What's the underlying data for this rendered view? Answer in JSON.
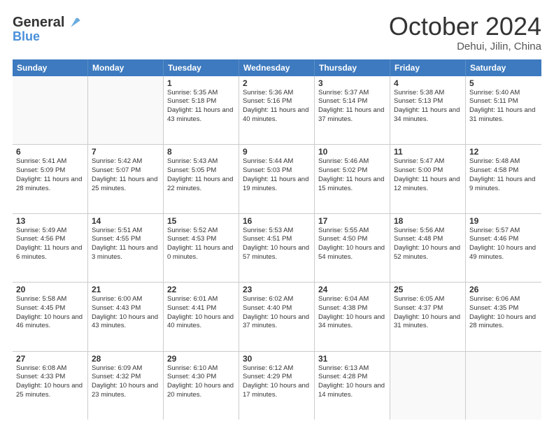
{
  "header": {
    "logo_general": "General",
    "logo_blue": "Blue",
    "month_title": "October 2024",
    "location": "Dehui, Jilin, China"
  },
  "days_of_week": [
    "Sunday",
    "Monday",
    "Tuesday",
    "Wednesday",
    "Thursday",
    "Friday",
    "Saturday"
  ],
  "weeks": [
    [
      {
        "day": "",
        "text": ""
      },
      {
        "day": "",
        "text": ""
      },
      {
        "day": "1",
        "text": "Sunrise: 5:35 AM\nSunset: 5:18 PM\nDaylight: 11 hours and 43 minutes."
      },
      {
        "day": "2",
        "text": "Sunrise: 5:36 AM\nSunset: 5:16 PM\nDaylight: 11 hours and 40 minutes."
      },
      {
        "day": "3",
        "text": "Sunrise: 5:37 AM\nSunset: 5:14 PM\nDaylight: 11 hours and 37 minutes."
      },
      {
        "day": "4",
        "text": "Sunrise: 5:38 AM\nSunset: 5:13 PM\nDaylight: 11 hours and 34 minutes."
      },
      {
        "day": "5",
        "text": "Sunrise: 5:40 AM\nSunset: 5:11 PM\nDaylight: 11 hours and 31 minutes."
      }
    ],
    [
      {
        "day": "6",
        "text": "Sunrise: 5:41 AM\nSunset: 5:09 PM\nDaylight: 11 hours and 28 minutes."
      },
      {
        "day": "7",
        "text": "Sunrise: 5:42 AM\nSunset: 5:07 PM\nDaylight: 11 hours and 25 minutes."
      },
      {
        "day": "8",
        "text": "Sunrise: 5:43 AM\nSunset: 5:05 PM\nDaylight: 11 hours and 22 minutes."
      },
      {
        "day": "9",
        "text": "Sunrise: 5:44 AM\nSunset: 5:03 PM\nDaylight: 11 hours and 19 minutes."
      },
      {
        "day": "10",
        "text": "Sunrise: 5:46 AM\nSunset: 5:02 PM\nDaylight: 11 hours and 15 minutes."
      },
      {
        "day": "11",
        "text": "Sunrise: 5:47 AM\nSunset: 5:00 PM\nDaylight: 11 hours and 12 minutes."
      },
      {
        "day": "12",
        "text": "Sunrise: 5:48 AM\nSunset: 4:58 PM\nDaylight: 11 hours and 9 minutes."
      }
    ],
    [
      {
        "day": "13",
        "text": "Sunrise: 5:49 AM\nSunset: 4:56 PM\nDaylight: 11 hours and 6 minutes."
      },
      {
        "day": "14",
        "text": "Sunrise: 5:51 AM\nSunset: 4:55 PM\nDaylight: 11 hours and 3 minutes."
      },
      {
        "day": "15",
        "text": "Sunrise: 5:52 AM\nSunset: 4:53 PM\nDaylight: 11 hours and 0 minutes."
      },
      {
        "day": "16",
        "text": "Sunrise: 5:53 AM\nSunset: 4:51 PM\nDaylight: 10 hours and 57 minutes."
      },
      {
        "day": "17",
        "text": "Sunrise: 5:55 AM\nSunset: 4:50 PM\nDaylight: 10 hours and 54 minutes."
      },
      {
        "day": "18",
        "text": "Sunrise: 5:56 AM\nSunset: 4:48 PM\nDaylight: 10 hours and 52 minutes."
      },
      {
        "day": "19",
        "text": "Sunrise: 5:57 AM\nSunset: 4:46 PM\nDaylight: 10 hours and 49 minutes."
      }
    ],
    [
      {
        "day": "20",
        "text": "Sunrise: 5:58 AM\nSunset: 4:45 PM\nDaylight: 10 hours and 46 minutes."
      },
      {
        "day": "21",
        "text": "Sunrise: 6:00 AM\nSunset: 4:43 PM\nDaylight: 10 hours and 43 minutes."
      },
      {
        "day": "22",
        "text": "Sunrise: 6:01 AM\nSunset: 4:41 PM\nDaylight: 10 hours and 40 minutes."
      },
      {
        "day": "23",
        "text": "Sunrise: 6:02 AM\nSunset: 4:40 PM\nDaylight: 10 hours and 37 minutes."
      },
      {
        "day": "24",
        "text": "Sunrise: 6:04 AM\nSunset: 4:38 PM\nDaylight: 10 hours and 34 minutes."
      },
      {
        "day": "25",
        "text": "Sunrise: 6:05 AM\nSunset: 4:37 PM\nDaylight: 10 hours and 31 minutes."
      },
      {
        "day": "26",
        "text": "Sunrise: 6:06 AM\nSunset: 4:35 PM\nDaylight: 10 hours and 28 minutes."
      }
    ],
    [
      {
        "day": "27",
        "text": "Sunrise: 6:08 AM\nSunset: 4:33 PM\nDaylight: 10 hours and 25 minutes."
      },
      {
        "day": "28",
        "text": "Sunrise: 6:09 AM\nSunset: 4:32 PM\nDaylight: 10 hours and 23 minutes."
      },
      {
        "day": "29",
        "text": "Sunrise: 6:10 AM\nSunset: 4:30 PM\nDaylight: 10 hours and 20 minutes."
      },
      {
        "day": "30",
        "text": "Sunrise: 6:12 AM\nSunset: 4:29 PM\nDaylight: 10 hours and 17 minutes."
      },
      {
        "day": "31",
        "text": "Sunrise: 6:13 AM\nSunset: 4:28 PM\nDaylight: 10 hours and 14 minutes."
      },
      {
        "day": "",
        "text": ""
      },
      {
        "day": "",
        "text": ""
      }
    ]
  ]
}
